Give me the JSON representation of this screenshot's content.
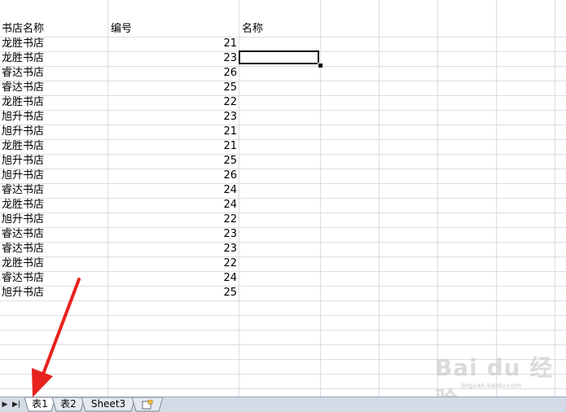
{
  "headers": {
    "a": "书店名称",
    "b": "编号",
    "c": "名称"
  },
  "rows": [
    {
      "name": "龙胜书店",
      "num": "21"
    },
    {
      "name": "龙胜书店",
      "num": "23"
    },
    {
      "name": "睿达书店",
      "num": "26"
    },
    {
      "name": "睿达书店",
      "num": "25"
    },
    {
      "name": "龙胜书店",
      "num": "22"
    },
    {
      "name": "旭升书店",
      "num": "23"
    },
    {
      "name": "旭升书店",
      "num": "21"
    },
    {
      "name": "龙胜书店",
      "num": "21"
    },
    {
      "name": "旭升书店",
      "num": "25"
    },
    {
      "name": "旭升书店",
      "num": "26"
    },
    {
      "name": "睿达书店",
      "num": "24"
    },
    {
      "name": "龙胜书店",
      "num": "24"
    },
    {
      "name": "旭升书店",
      "num": "22"
    },
    {
      "name": "睿达书店",
      "num": "23"
    },
    {
      "name": "睿达书店",
      "num": "23"
    },
    {
      "name": "龙胜书店",
      "num": "22"
    },
    {
      "name": "睿达书店",
      "num": "24"
    },
    {
      "name": "旭升书店",
      "num": "25"
    }
  ],
  "sheet_tabs": [
    {
      "label": "表1",
      "active": true
    },
    {
      "label": "表2",
      "active": false
    },
    {
      "label": "Sheet3",
      "active": false
    }
  ],
  "nav": {
    "next": "▶",
    "last": "▶|"
  },
  "watermark": {
    "text": "Bai du 经验",
    "sub": "jingyan.baidu.com"
  },
  "colors": {
    "arrow": "#e8231f",
    "grid": "#d9dee6",
    "tabbar": "#d4dbe6"
  }
}
